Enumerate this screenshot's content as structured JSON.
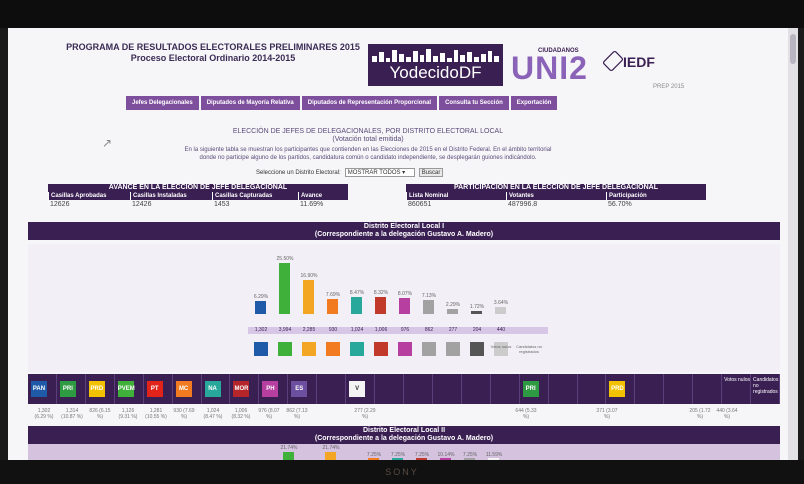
{
  "header": {
    "title_line1": "PROGRAMA DE RESULTADOS ELECTORALES PRELIMINARES 2015",
    "title_line2": "Proceso Electoral Ordinario 2014-2015",
    "logo_text": "YodecidoDF",
    "uni_small": "CIUDADANOS",
    "uni": "UNI2",
    "iedf": "IEDF",
    "prep": "PREP 2015"
  },
  "nav": [
    "Jefes Delegacionales",
    "Diputados de Mayoría Relativa",
    "Diputados de Representación Proporcional",
    "Consulta tu Sección",
    "Exportación"
  ],
  "section": {
    "title_line1": "ELECCIÓN DE JEFES DE DELEGACIONALES, POR DISTRITO ELECTORAL LOCAL",
    "title_line2": "(Votación total emitida)",
    "intro_line1": "En la siguiente tabla se muestran los participantes que contienden en las Elecciones de 2015 en el Distrito Federal. En el ámbito territorial",
    "intro_line2": "donde no participe alguno de los partidos, candidatura común o candidato independiente, se desplegarán guiones indicándolo.",
    "select_label": "Seleccione un Distrito Electoral:",
    "select_value": "MOSTRAR TODOS",
    "search_button": "Buscar"
  },
  "avance": {
    "title": "AVANCE EN LA ELECCIÓN DE JEFE DELEGACIONAL",
    "columns": [
      "Casillas Aprobadas",
      "Casillas Instaladas",
      "Casillas Capturadas",
      "Avance"
    ],
    "values": [
      "12626",
      "12426",
      "1453",
      "11.69%"
    ]
  },
  "participacion": {
    "title": "PARTICIPACIÓN EN LA ELECCIÓN DE JEFE DELEGACIONAL",
    "columns": [
      "Lista Nominal",
      "Votantes",
      "Participación"
    ],
    "values": [
      "860651",
      "487996.8",
      "56.70%"
    ]
  },
  "district1": {
    "title": "Distrito Electoral Local I",
    "subtitle": "(Correspondiente a la delegación Gustavo A. Madero)",
    "bars": [
      {
        "party": "PAN",
        "pct": "6.29%",
        "value": 6.29,
        "votes": "1,302",
        "color": "#1e5aa8"
      },
      {
        "party": "PRI-PVEM",
        "pct": "25.50%",
        "value": 25.5,
        "votes": "3,994",
        "color": "#3fb03a"
      },
      {
        "party": "PRD-PT",
        "pct": "16.90%",
        "value": 16.9,
        "votes": "2,285",
        "color": "#f3a623"
      },
      {
        "party": "MC",
        "pct": "7.69%",
        "value": 7.69,
        "votes": "930",
        "color": "#f27b22"
      },
      {
        "party": "NA",
        "pct": "8.47%",
        "value": 8.47,
        "votes": "1,024",
        "color": "#28a89b"
      },
      {
        "party": "MORENA",
        "pct": "8.32%",
        "value": 8.32,
        "votes": "1,006",
        "color": "#c0392b"
      },
      {
        "party": "PH",
        "pct": "8.07%",
        "value": 8.07,
        "votes": "976",
        "color": "#b63fa0"
      },
      {
        "party": "ES",
        "pct": "7.13%",
        "value": 7.13,
        "votes": "862",
        "color": "#a2a2a2"
      },
      {
        "party": "IND",
        "pct": "2.29%",
        "value": 2.29,
        "votes": "277",
        "color": "#a2a2a2"
      },
      {
        "party": "NR",
        "pct": "1.72%",
        "value": 1.72,
        "votes": "204",
        "color": "#555555"
      },
      {
        "party": "NUL",
        "pct": "3.64%",
        "value": 3.64,
        "votes": "440",
        "color": "#cccccc"
      }
    ],
    "logo_caps": [
      "Votos nulos",
      "Candidatos no registrados"
    ]
  },
  "band": {
    "cells": [
      "PAN",
      "PRI",
      "PRD",
      "PVEM",
      "PT",
      "MC",
      "NA",
      "MOR",
      "PH",
      "ES",
      "",
      "V",
      "",
      "",
      "",
      "",
      "",
      "PRI",
      "",
      "",
      "PRD",
      "",
      "",
      "",
      "Votos nulos",
      "Candidatos no registrados"
    ],
    "values": [
      "1,302 (6.29 %)",
      "1,314 (10.87 %)",
      "826 (6.15 %)",
      "1,126 (9.31 %)",
      "1,281 (10.55 %)",
      "930 (7.69 %)",
      "1,024 (8.47 %)",
      "1,006 (8.32 %)",
      "976 (8.07 %)",
      "862 (7.13 %)",
      "277 (2.29 %)",
      "644 (5.33 %)",
      "371 (3.07 %)",
      "205 (1.72 %)",
      "440 (3.64 %)"
    ]
  },
  "district2": {
    "title": "Distrito Electoral Local II",
    "subtitle": "(Correspondiente a la delegación Gustavo A. Madero)",
    "pcts": [
      "21.74%",
      "21.74%",
      "7.25%",
      "7.25%",
      "7.25%",
      "10.14%",
      "7.25%",
      "11.59%"
    ]
  },
  "bezel": {
    "brand": "SONY"
  }
}
